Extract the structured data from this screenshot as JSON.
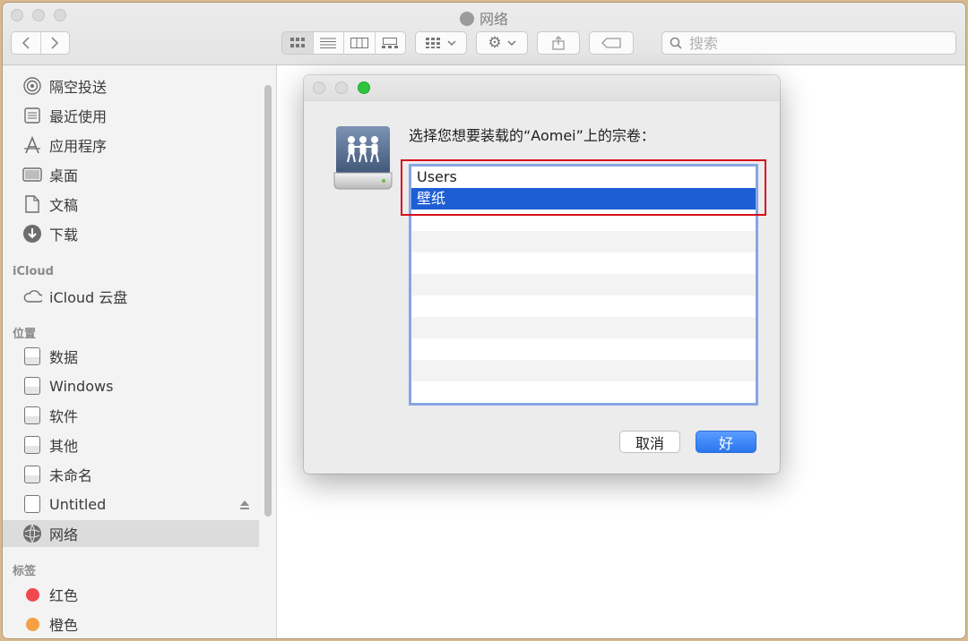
{
  "window": {
    "title": "网络",
    "search_placeholder": "搜索"
  },
  "sidebar": {
    "favorites": [
      {
        "label": "隔空投送",
        "icon": "airdrop-icon"
      },
      {
        "label": "最近使用",
        "icon": "recents-icon"
      },
      {
        "label": "应用程序",
        "icon": "applications-icon"
      },
      {
        "label": "桌面",
        "icon": "desktop-icon"
      },
      {
        "label": "文稿",
        "icon": "documents-icon"
      },
      {
        "label": "下载",
        "icon": "downloads-icon"
      }
    ],
    "icloud_header": "iCloud",
    "icloud_items": [
      {
        "label": "iCloud 云盘",
        "icon": "cloud-icon"
      }
    ],
    "locations_header": "位置",
    "locations": [
      {
        "label": "数据",
        "icon": "disk-icon"
      },
      {
        "label": "Windows",
        "icon": "disk-icon"
      },
      {
        "label": "软件",
        "icon": "disk-icon"
      },
      {
        "label": "其他",
        "icon": "disk-icon"
      },
      {
        "label": "未命名",
        "icon": "disk-icon"
      },
      {
        "label": "Untitled",
        "icon": "disk-icon"
      },
      {
        "label": "网络",
        "icon": "network-icon"
      }
    ],
    "tags_header": "标签",
    "tags": [
      {
        "label": "红色",
        "color": "#f1484e"
      },
      {
        "label": "橙色",
        "color": "#f5a044"
      }
    ]
  },
  "dialog": {
    "prompt": "选择您想要装载的“Aomei”上的宗卷：",
    "volumes": [
      "Users",
      "壁纸"
    ],
    "selected_index": 1,
    "cancel_label": "取消",
    "ok_label": "好"
  },
  "colors": {
    "selection": "#1d5ed5",
    "highlight_box": "#d80f1c",
    "primary_button": "#2a76ee"
  }
}
